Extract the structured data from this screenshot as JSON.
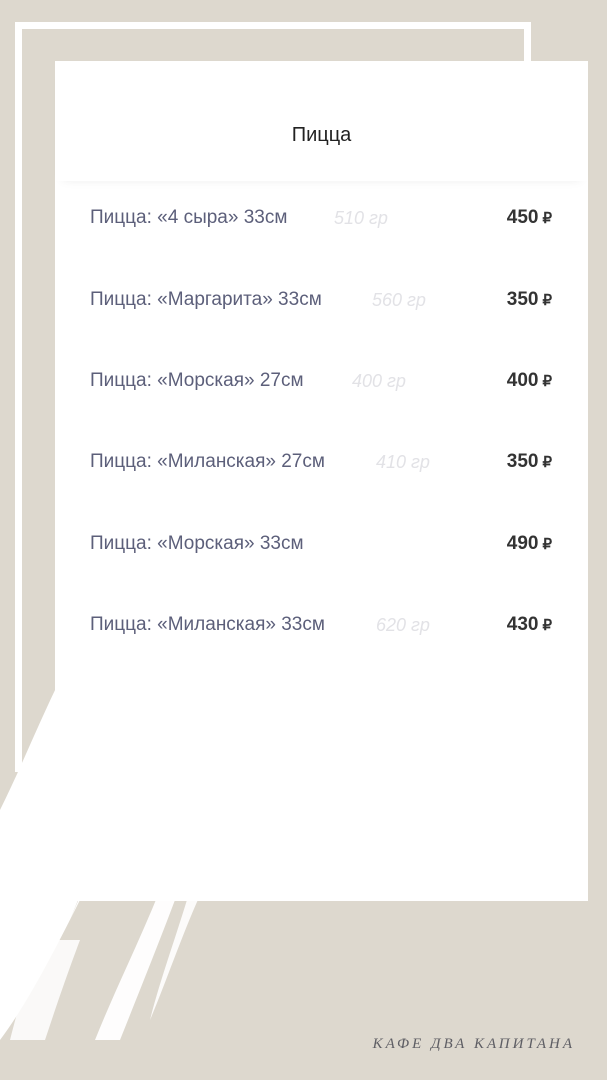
{
  "header": {
    "title": "Пицца"
  },
  "menu": {
    "items": [
      {
        "name": "Пицца: «4 сыра» 33см",
        "weight": "510 гр",
        "price": "450",
        "currency": "₽"
      },
      {
        "name": "Пицца: «Маргарита» 33см",
        "weight": "560 гр",
        "price": "350",
        "currency": "₽"
      },
      {
        "name": "Пицца: «Морская» 27см",
        "weight": "400 гр",
        "price": "400",
        "currency": "₽"
      },
      {
        "name": "Пицца: «Миланская» 27см",
        "weight": "410 гр",
        "price": "350",
        "currency": "₽"
      },
      {
        "name": "Пицца: «Морская» 33см",
        "weight": "",
        "price": "490",
        "currency": "₽"
      },
      {
        "name": "Пицца: «Миланская» 33см",
        "weight": "620 гр",
        "price": "430",
        "currency": "₽"
      }
    ]
  },
  "footer": {
    "brand": "КАФЕ ДВА КАПИТАНА"
  },
  "colors": {
    "background": "#ddd8ce",
    "card": "#ffffff",
    "item_name": "#5c5f7a",
    "weight": "#e2e2e6",
    "price": "#333333"
  }
}
